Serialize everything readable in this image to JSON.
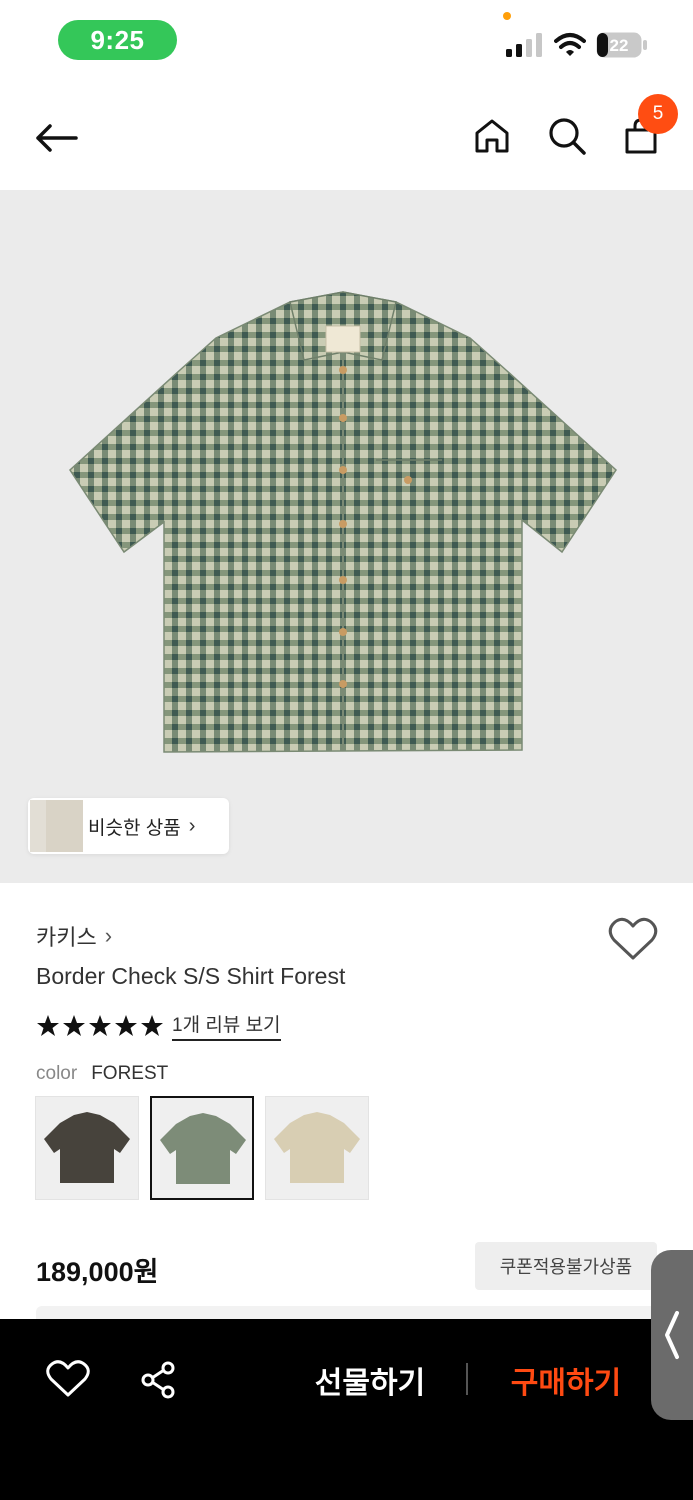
{
  "status_bar": {
    "time": "9:25",
    "battery_level": "22"
  },
  "header": {
    "cart_count": "5"
  },
  "hero": {
    "similar_label": "비슷한 상품",
    "similar_chevron": "›"
  },
  "product": {
    "brand": "카키스",
    "brand_chevron": "›",
    "title": "Border Check S/S Shirt Forest",
    "rating_stars": 5,
    "review_link": "1개 리뷰 보기",
    "color_label": "color",
    "color_value": "FOREST",
    "swatches": [
      {
        "name": "dark",
        "color": "#47433c",
        "selected": false
      },
      {
        "name": "forest",
        "color": "#7d8c78",
        "selected": true
      },
      {
        "name": "beige",
        "color": "#d8ceb3",
        "selected": false
      }
    ],
    "price": "189,000원",
    "coupon_notice": "쿠폰적용불가상품"
  },
  "bottom_bar": {
    "gift_label": "선물하기",
    "buy_label": "구매하기"
  },
  "colors": {
    "accent": "#ff4a12",
    "badge": "#ff4d12",
    "time_pill": "#34c759",
    "hero_bg": "#ebebeb"
  },
  "icons": [
    "back-arrow-icon",
    "home-icon",
    "search-icon",
    "shopping-bag-icon",
    "heart-icon",
    "star-icon",
    "share-icon",
    "chevron-left-icon"
  ]
}
